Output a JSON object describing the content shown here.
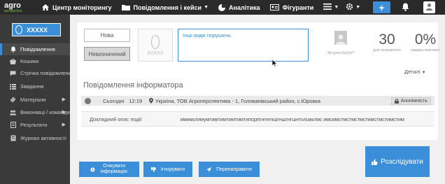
{
  "topbar": {
    "logo_main": "agro",
    "logo_sub": "perspectiva",
    "nav": [
      {
        "label": "Центр моніторингу",
        "icon": "home-icon"
      },
      {
        "label": "Повідомлення і кейси",
        "icon": "folder-icon"
      },
      {
        "label": "Аналітика",
        "icon": "pie-chart-icon"
      },
      {
        "label": "Фігуранти",
        "icon": "id-card-icon"
      }
    ],
    "add_label": "+"
  },
  "sidebar": {
    "org_name": "XXXXX",
    "items": [
      {
        "label": "Повідомлення",
        "icon": "bell-icon"
      },
      {
        "label": "Кошики",
        "icon": "basket-icon"
      },
      {
        "label": "Стрічка повідомлень",
        "icon": "feed-icon"
      },
      {
        "label": "Завдання",
        "icon": "tasks-icon"
      },
      {
        "label": "Матеріали",
        "icon": "materials-icon"
      },
      {
        "label": "Виконавці / команди",
        "icon": "users-icon"
      },
      {
        "label": "Результати",
        "icon": "results-icon"
      },
      {
        "label": "Журнал активності",
        "icon": "journal-icon"
      }
    ]
  },
  "report": {
    "status_new": "Нова",
    "status_undefined": "Невизначений",
    "thumb_text": "XXXXX",
    "violation_type": "Інші види порушень",
    "informer_label": "Фігурант(ы)/ні?",
    "stats": [
      {
        "value": "30",
        "label": "днів залишилося"
      },
      {
        "value": "0%",
        "label": "завдань виконано"
      }
    ]
  },
  "info": {
    "title": "Повідомлення інформатора",
    "date": "Сьогодні",
    "time": "12:19",
    "location": "Україна, ТОВ Агроперспектива - 1, Голованівський район, с.Юровка",
    "anonymity": "Анонімність",
    "description_label": "Докладний опис події",
    "description_value": "имимьтимумтимтимтимтимтипорпгнгнгншгншгнгшнтьтьмьтмс имсимстмстмстмстимстмстимстим",
    "details": "Деталі"
  },
  "actions": {
    "contact": "Очікувати інформацію",
    "ignore": "Ігнорувати",
    "redirect": "Перенаправити",
    "investigate": "Розслідувати"
  },
  "colors": {
    "accent": "#3b8fd8",
    "topbar": "#2a2a2a",
    "sidebar": "#3a3a3a"
  }
}
